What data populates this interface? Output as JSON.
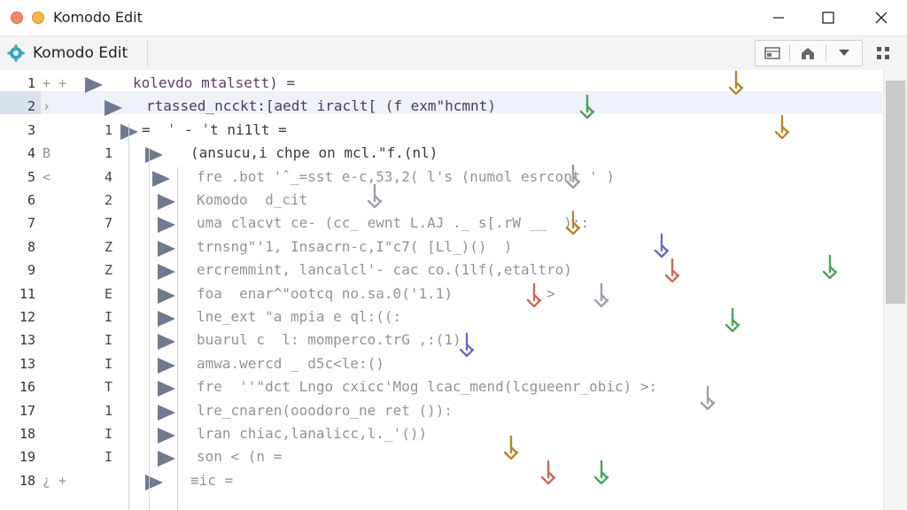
{
  "window": {
    "title": "Komodo Edit"
  },
  "toolbar": {
    "title": "Komodo Edit"
  },
  "editor": {
    "line_numbers": [
      "1",
      "2",
      "3",
      "4",
      "5",
      "6",
      "7",
      "8",
      "9",
      "11",
      "12",
      "13",
      "13",
      "16",
      "17",
      "18",
      "19",
      "18"
    ],
    "gutter_marks": [
      "+ +",
      "›",
      "",
      "B",
      "<",
      "",
      "",
      "",
      "",
      "",
      "",
      "",
      "",
      "",
      "",
      "",
      "",
      "¿ +"
    ],
    "fold_numbers": [
      "",
      "",
      "1",
      "1",
      "4",
      "2",
      "7",
      "Z",
      "Z",
      "E",
      "I",
      "I",
      "I",
      "T",
      "1",
      "I",
      "I",
      ""
    ],
    "lines": [
      "kolevdo mtalsett) =",
      "rtassed_ncckt:[aedt iraclt[ (f exm\"hcmnt)",
      "=  ˈ - ˈt ni1lt =",
      "(ansucu,i chpe on mcl.\"f.(nl)",
      "fre .bot 'ˆ_=sst e-c,53,2( l's (numol esrcont ' )",
      "Komodo  d_cit",
      "uma clacvt ce- (cc_ ewnt L.AJ ._ s[.rW __  )::",
      "trnsng\"'1, Insacrn-c,I\"c7( [Ll_)()  )",
      "ercremmint, lancalcl'- cac co.(1lf(,etaltro)",
      "foa  enar^\"ootcq no.sa.0('1.1)           >",
      "lne_ext \"a mpia e ql:((:",
      "buarul c  l: momperco.trG ,:(1)",
      "amwa.wercd _ d5c<le:()",
      "fre  ''\"dct Lngo cxicc'Mog lcac_mend(lcgueenr_obic) >:",
      "lre_cnaren(ooodoro_ne ret ()):",
      "lran chiac,lanalicc,l._'()) ",
      "son < (n =",
      "≡ic ="
    ]
  },
  "colors": {
    "accent_toolbar_icon": "#3ba3c4",
    "current_line": "#eef1f7",
    "code_text": "#3a3a3a",
    "arrows": [
      "#b8862e",
      "#4aa35a",
      "#c96a5a",
      "#6a6ac9",
      "#9aa0a8"
    ]
  },
  "icons": [
    "close-traffic-icon",
    "minimize-traffic-icon",
    "gear-icon",
    "minimize-icon",
    "maximize-icon",
    "close-icon",
    "panel-icon",
    "home-icon",
    "dropdown-icon",
    "grid-icon",
    "fold-triangle-icon",
    "cursor-arrow-icon"
  ]
}
